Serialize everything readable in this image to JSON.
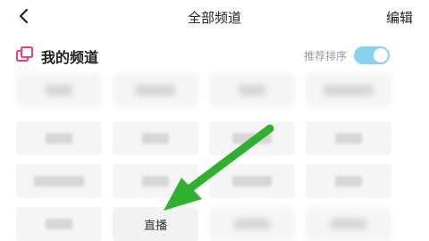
{
  "navbar": {
    "title": "全部频道",
    "edit_label": "编辑",
    "back_icon": "chevron-left-icon"
  },
  "my_channels": {
    "title": "我的频道",
    "recommend_sort_label": "推荐排序",
    "toggle_on": true,
    "icon": "channels-icon",
    "accent_color": "#ee3f74",
    "toggle_color": "#86d2ef"
  },
  "channels": [
    {
      "label": ""
    },
    {
      "label": ""
    },
    {
      "label": ""
    },
    {
      "label": ""
    },
    {
      "label": ""
    },
    {
      "label": ""
    },
    {
      "label": ""
    },
    {
      "label": ""
    },
    {
      "label": ""
    },
    {
      "label": ""
    },
    {
      "label": ""
    },
    {
      "label": ""
    },
    {
      "label": ""
    },
    {
      "label": "直播"
    },
    {
      "label": ""
    },
    {
      "label": ""
    }
  ],
  "annotation": {
    "arrow_color": "#2fb12f"
  }
}
